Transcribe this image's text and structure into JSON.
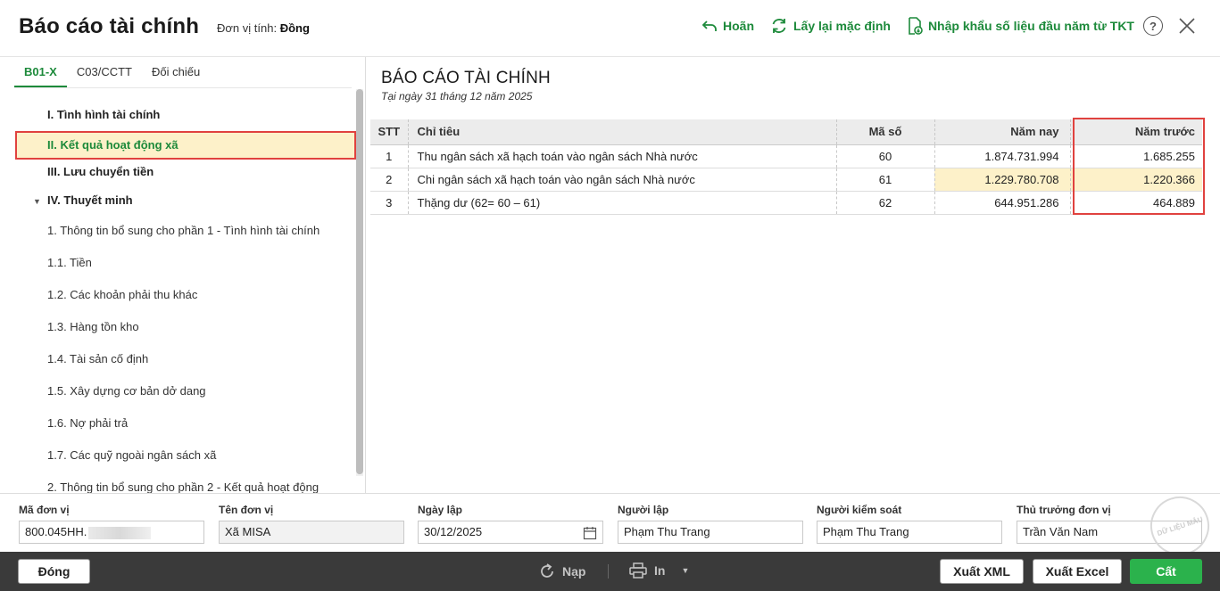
{
  "header": {
    "title": "Báo cáo tài chính",
    "unit_label": "Đơn vị tính:",
    "unit_value": "Đồng",
    "undo_label": "Hoãn",
    "reset_label": "Lấy lại mặc định",
    "import_label": "Nhập khẩu số liệu đầu năm từ TKT",
    "help_label": "?"
  },
  "tabs": [
    "B01-X",
    "C03/CCTT",
    "Đối chiếu"
  ],
  "tree": [
    {
      "label": "I. Tình hình tài chính"
    },
    {
      "label": "II. Kết quả hoạt động xã"
    },
    {
      "label": "III. Lưu chuyển tiền"
    },
    {
      "label": "IV. Thuyết minh"
    },
    {
      "label": "1. Thông tin bổ sung cho phần 1 - Tình hình tài chính"
    },
    {
      "label": "1.1. Tiền"
    },
    {
      "label": "1.2. Các khoản phải thu khác"
    },
    {
      "label": "1.3. Hàng tồn kho"
    },
    {
      "label": "1.4. Tài sản cố định"
    },
    {
      "label": "1.5. Xây dựng cơ bản dở dang"
    },
    {
      "label": "1.6. Nợ phải trả"
    },
    {
      "label": "1.7. Các quỹ ngoài ngân sách xã"
    },
    {
      "label": "2. Thông tin bổ sung cho phần 2 - Kết quả hoạt động"
    }
  ],
  "report": {
    "title": "BÁO CÁO TÀI CHÍNH",
    "subtitle": "Tại ngày 31 tháng 12 năm 2025",
    "columns": [
      "STT",
      "Chỉ tiêu",
      "Mã số",
      "Năm nay",
      "Năm trước"
    ],
    "rows": [
      {
        "stt": "1",
        "name": "Thu ngân sách xã hạch toán vào ngân sách Nhà nước",
        "code": "60",
        "this_year": "1.874.731.994",
        "last_year": "1.685.255"
      },
      {
        "stt": "2",
        "name": "Chi ngân sách xã hạch toán vào ngân sách Nhà nước",
        "code": "61",
        "this_year": "1.229.780.708",
        "last_year": "1.220.366"
      },
      {
        "stt": "3",
        "name": "Thặng dư (62= 60 – 61)",
        "code": "62",
        "this_year": "644.951.286",
        "last_year": "464.889"
      }
    ]
  },
  "form": {
    "ma_don_vi": {
      "label": "Mã đơn vị",
      "value": "800.045HH."
    },
    "ten_don_vi": {
      "label": "Tên đơn vị",
      "value": "Xã MISA"
    },
    "ngay_lap": {
      "label": "Ngày lập",
      "value": "30/12/2025"
    },
    "nguoi_lap": {
      "label": "Người lập",
      "value": "Phạm Thu Trang"
    },
    "nguoi_kiem_soat": {
      "label": "Người kiểm soát",
      "value": "Phạm Thu Trang"
    },
    "thu_truong": {
      "label": "Thủ trưởng đơn vị",
      "value": "Trần Văn Nam"
    }
  },
  "stamp_text": "DỮ LIỆU MẪU",
  "footer": {
    "close_label": "Đóng",
    "reload_label": "Nạp",
    "print_label": "In",
    "xml_label": "Xuất XML",
    "excel_label": "Xuất Excel",
    "save_label": "Cất"
  },
  "colors": {
    "accent": "#1d8a3b",
    "highlight": "#fdf1c9",
    "marker": "#e0423f",
    "bar": "#3a3a3a"
  }
}
